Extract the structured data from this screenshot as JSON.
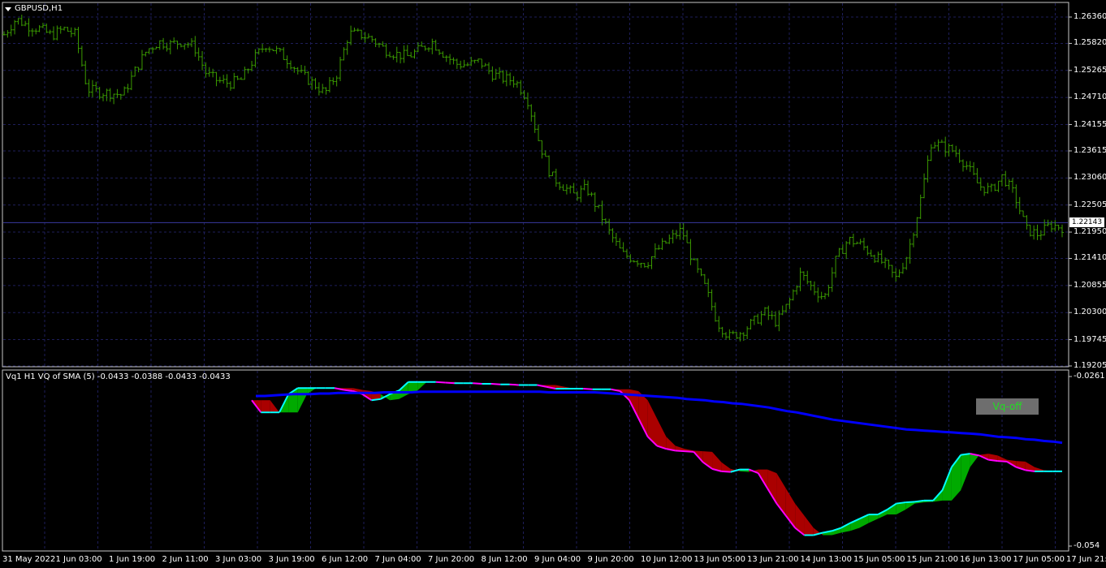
{
  "chart_header": {
    "symbol_label": "GBPUSD,H1"
  },
  "indicator_header": {
    "label": "Vq1 H1 VQ of SMA (5) -0.0433 -0.0388 -0.0433 -0.0433"
  },
  "vq_button": {
    "label": "Vq-off"
  },
  "current_price": "1.22143",
  "colors": {
    "bull": "#00aa00",
    "bull_edge": "#00ffff",
    "bear": "#aa0000",
    "bear_edge": "#ff00ff",
    "ma": "#0000ff",
    "grid": "#1e1e5a",
    "bars": "#3a9a00"
  },
  "chart_data": [
    {
      "type": "bar",
      "series_kind": "OHLC bars",
      "price_axis_ticks": [
        "1.26360",
        "1.25820",
        "1.25265",
        "1.24710",
        "1.24155",
        "1.23615",
        "1.23060",
        "1.22505",
        "1.21950",
        "1.21410",
        "1.20855",
        "1.20300",
        "1.19745",
        "1.19205"
      ],
      "ylim": [
        1.19205,
        1.2636
      ],
      "close_path": [
        1.26,
        1.2632,
        1.2618,
        1.2612,
        1.2598,
        1.2612,
        1.26,
        1.2488,
        1.2482,
        1.248,
        1.2476,
        1.2525,
        1.2568,
        1.2585,
        1.258,
        1.2586,
        1.2575,
        1.252,
        1.2505,
        1.25,
        1.2508,
        1.255,
        1.258,
        1.2565,
        1.2545,
        1.2518,
        1.25,
        1.248,
        1.252,
        1.2602,
        1.26,
        1.259,
        1.257,
        1.256,
        1.2555,
        1.257,
        1.2585,
        1.256,
        1.254,
        1.2538,
        1.2545,
        1.252,
        1.251,
        1.2505,
        1.247,
        1.238,
        1.231,
        1.229,
        1.227,
        1.2285,
        1.224,
        1.219,
        1.215,
        1.214,
        1.213,
        1.216,
        1.218,
        1.22,
        1.213,
        1.208,
        1.201,
        1.198,
        1.199,
        1.201,
        1.203,
        1.201,
        1.205,
        1.211,
        1.208,
        1.206,
        1.214,
        1.218,
        1.217,
        1.215,
        1.213,
        1.21,
        1.215,
        1.225,
        1.238,
        1.237,
        1.236,
        1.233,
        1.229,
        1.228,
        1.231,
        1.227,
        1.22,
        1.219,
        1.221,
        1.2205
      ]
    },
    {
      "type": "area",
      "series_kind": "VQ of SMA oscillator",
      "price_axis_ticks": [
        "-0.0261",
        "-0.054"
      ],
      "ylim": [
        -0.054,
        -0.0261
      ],
      "x_ticks": [
        "31 May 2022",
        "1 Jun 03:00",
        "1 Jun 19:00",
        "2 Jun 11:00",
        "3 Jun 03:00",
        "3 Jun 19:00",
        "6 Jun 12:00",
        "7 Jun 04:00",
        "7 Jun 20:00",
        "8 Jun 12:00",
        "9 Jun 04:00",
        "9 Jun 20:00",
        "10 Jun 12:00",
        "13 Jun 05:00",
        "13 Jun 21:00",
        "14 Jun 13:00",
        "15 Jun 05:00",
        "15 Jun 21:00",
        "16 Jun 13:00",
        "17 Jun 05:00",
        "17 Jun 21:00"
      ],
      "vq_fast": [
        -0.03,
        -0.032,
        -0.032,
        -0.032,
        -0.029,
        -0.028,
        -0.028,
        -0.028,
        -0.028,
        -0.028,
        -0.0283,
        -0.0285,
        -0.029,
        -0.03,
        -0.0298,
        -0.029,
        -0.0284,
        -0.027,
        -0.027,
        -0.027,
        -0.027,
        -0.0271,
        -0.0272,
        -0.0272,
        -0.0272,
        -0.0273,
        -0.0273,
        -0.0274,
        -0.0274,
        -0.0275,
        -0.0275,
        -0.0275,
        -0.0278,
        -0.0281,
        -0.0281,
        -0.0281,
        -0.0281,
        -0.0282,
        -0.0282,
        -0.0282,
        -0.0285,
        -0.03,
        -0.033,
        -0.036,
        -0.0375,
        -0.038,
        -0.0383,
        -0.0384,
        -0.0385,
        -0.0402,
        -0.0413,
        -0.0417,
        -0.0418,
        -0.0414,
        -0.0414,
        -0.042,
        -0.0445,
        -0.047,
        -0.049,
        -0.051,
        -0.0522,
        -0.0522,
        -0.0518,
        -0.0515,
        -0.051,
        -0.0502,
        -0.0495,
        -0.0488,
        -0.0488,
        -0.048,
        -0.047,
        -0.0468,
        -0.0467,
        -0.0465,
        -0.0465,
        -0.0448,
        -0.041,
        -0.039,
        -0.0388,
        -0.0391,
        -0.0398,
        -0.04,
        -0.0401,
        -0.041,
        -0.0415,
        -0.0417,
        -0.0417,
        -0.0417,
        -0.0417
      ],
      "ma": [
        -0.0293,
        -0.0293,
        -0.0292,
        -0.0291,
        -0.029,
        -0.029,
        -0.029,
        -0.0289,
        -0.0289,
        -0.0288,
        -0.0288,
        -0.0288,
        -0.0288,
        -0.0288,
        -0.0287,
        -0.0287,
        -0.0287,
        -0.0287,
        -0.0286,
        -0.0286,
        -0.0286,
        -0.0286,
        -0.0286,
        -0.0286,
        -0.0286,
        -0.0286,
        -0.0286,
        -0.0286,
        -0.0286,
        -0.0286,
        -0.0286,
        -0.0286,
        -0.0287,
        -0.0287,
        -0.0287,
        -0.0287,
        -0.0287,
        -0.0287,
        -0.0288,
        -0.0289,
        -0.029,
        -0.0291,
        -0.0292,
        -0.0293,
        -0.0294,
        -0.0295,
        -0.0296,
        -0.0298,
        -0.0299,
        -0.03,
        -0.0302,
        -0.0303,
        -0.0305,
        -0.0306,
        -0.0308,
        -0.031,
        -0.0312,
        -0.0315,
        -0.0318,
        -0.032,
        -0.0323,
        -0.0326,
        -0.0329,
        -0.0332,
        -0.0334,
        -0.0336,
        -0.0338,
        -0.034,
        -0.0342,
        -0.0344,
        -0.0346,
        -0.0348,
        -0.0349,
        -0.035,
        -0.0351,
        -0.0352,
        -0.0353,
        -0.0354,
        -0.0355,
        -0.0356,
        -0.0358,
        -0.036,
        -0.0361,
        -0.0362,
        -0.0364,
        -0.0365,
        -0.0367,
        -0.0368,
        -0.037
      ]
    }
  ]
}
